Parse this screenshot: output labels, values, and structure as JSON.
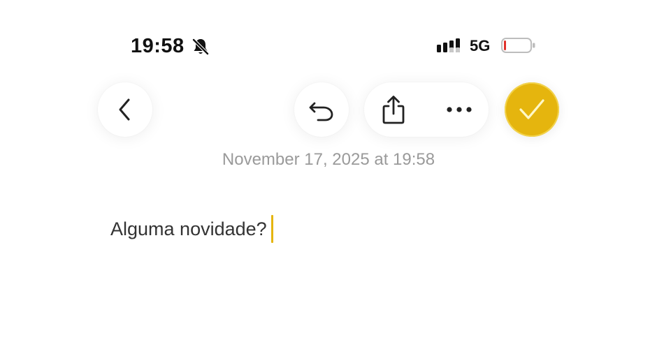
{
  "status_bar": {
    "time": "19:58",
    "network": "5G",
    "icons": {
      "silent": "bell-slash-icon",
      "signal": "cellular-signal-icon",
      "battery": "battery-low-icon"
    },
    "battery_level": 0.05,
    "battery_color": "#e0312b"
  },
  "toolbar": {
    "back_icon": "chevron-left-icon",
    "undo_icon": "undo-icon",
    "share_icon": "share-icon",
    "more_icon": "more-horizontal-icon",
    "done_icon": "checkmark-icon",
    "accent_color": "#e5b50e"
  },
  "note": {
    "date": "November 17, 2025 at 19:58",
    "body": "Alguma novidade?"
  }
}
